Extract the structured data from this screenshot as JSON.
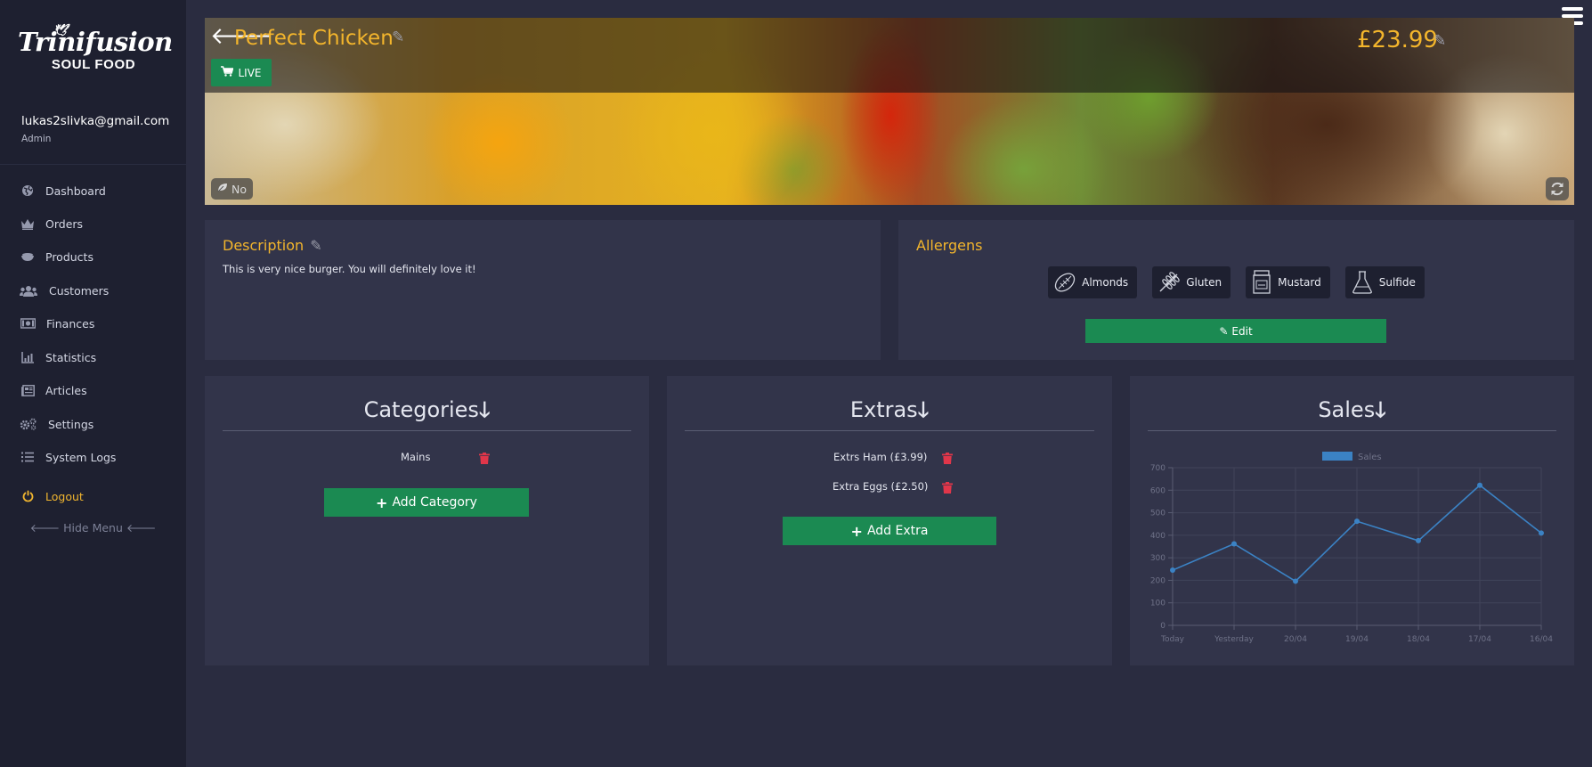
{
  "brand": {
    "script": "Trinifusion",
    "sub": "SOUL FOOD"
  },
  "user": {
    "email": "lukas2slivka@gmail.com",
    "role": "Admin"
  },
  "nav": [
    {
      "label": "Dashboard",
      "icon": "globe-icon"
    },
    {
      "label": "Orders",
      "icon": "crown-icon"
    },
    {
      "label": "Products",
      "icon": "bowl-icon"
    },
    {
      "label": "Customers",
      "icon": "users-icon"
    },
    {
      "label": "Finances",
      "icon": "money-icon"
    },
    {
      "label": "Statistics",
      "icon": "chart-icon"
    },
    {
      "label": "Articles",
      "icon": "newspaper-icon"
    },
    {
      "label": "Settings",
      "icon": "cogs-icon"
    },
    {
      "label": "System Logs",
      "icon": "list-icon"
    },
    {
      "label": "Logout",
      "icon": "power-icon"
    }
  ],
  "hide_menu": "Hide Menu",
  "product": {
    "title": "Perfect Chicken",
    "price": "£23.99",
    "status": "LIVE",
    "vegetarian": "No"
  },
  "description": {
    "heading": "Description",
    "text": "This is very nice burger. You will definitely love it!"
  },
  "allergens": {
    "heading": "Allergens",
    "items": [
      "Almonds",
      "Gluten",
      "Mustard",
      "Sulfide"
    ],
    "edit_label": "Edit"
  },
  "categories": {
    "heading": "Categories",
    "items": [
      "Mains"
    ],
    "add_label": "Add Category"
  },
  "extras": {
    "heading": "Extras",
    "items": [
      "Extrs Ham (£3.99)",
      "Extra Eggs (£2.50)"
    ],
    "add_label": "Add Extra"
  },
  "sales": {
    "heading": "Sales"
  },
  "colors": {
    "accent": "#f3b52c",
    "green": "#1b8a52",
    "danger": "#e0364a",
    "line": "#3b82c4"
  },
  "chart_data": {
    "type": "line",
    "legend": "Sales",
    "categories": [
      "Today",
      "Yesterday",
      "20/04",
      "19/04",
      "18/04",
      "17/04",
      "16/04"
    ],
    "values": [
      245,
      362,
      196,
      462,
      376,
      622,
      410
    ],
    "ylim": [
      0,
      700
    ],
    "yticks": [
      0,
      100,
      200,
      300,
      400,
      500,
      600,
      700
    ],
    "grid": true,
    "legend_position": "top-center"
  }
}
